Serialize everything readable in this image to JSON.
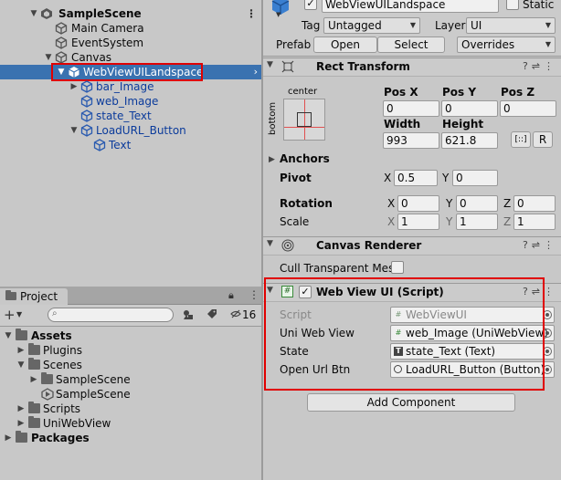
{
  "hierarchy": {
    "scene": "SampleScene",
    "items": [
      {
        "label": "Main Camera"
      },
      {
        "label": "EventSystem"
      },
      {
        "label": "Canvas"
      },
      {
        "label": "WebViewUILandspace"
      },
      {
        "label": "bar_Image"
      },
      {
        "label": "web_Image"
      },
      {
        "label": "state_Text"
      },
      {
        "label": "LoadURL_Button"
      },
      {
        "label": "Text"
      }
    ]
  },
  "project": {
    "tab": "Project",
    "lock_icon": "lock-icon",
    "hidden_count": "16",
    "items": [
      {
        "label": "Assets"
      },
      {
        "label": "Plugins"
      },
      {
        "label": "Scenes"
      },
      {
        "label": "SampleScene"
      },
      {
        "label": "SampleScene"
      },
      {
        "label": "Scripts"
      },
      {
        "label": "UniWebView"
      },
      {
        "label": "Packages"
      }
    ]
  },
  "inspector": {
    "object_name": "WebViewUILandspace",
    "static_label": "Static",
    "tag_label": "Tag",
    "tag_value": "Untagged",
    "layer_label": "Layer",
    "layer_value": "UI",
    "prefab_label": "Prefab",
    "open_label": "Open",
    "select_label": "Select",
    "overrides_label": "Overrides",
    "rect_transform": {
      "title": "Rect Transform",
      "anchor_h": "center",
      "anchor_v": "bottom",
      "posx_label": "Pos X",
      "posx": "0",
      "posy_label": "Pos Y",
      "posy": "0",
      "posz_label": "Pos Z",
      "posz": "0",
      "width_label": "Width",
      "width": "993",
      "height_label": "Height",
      "height": "621.8",
      "r_button": "R",
      "anchors_label": "Anchors",
      "pivot_label": "Pivot",
      "pivot_x": "0.5",
      "pivot_y": "0",
      "rotation_label": "Rotation",
      "rot_x": "0",
      "rot_y": "0",
      "rot_z": "0",
      "scale_label": "Scale",
      "scale_x": "1",
      "scale_y": "1",
      "scale_z": "1",
      "x": "X",
      "y": "Y",
      "z": "Z"
    },
    "canvas_renderer": {
      "title": "Canvas Renderer",
      "cull_label": "Cull Transparent Mes"
    },
    "web_view_ui": {
      "title": "Web View UI (Script)",
      "script_label": "Script",
      "script_value": "WebViewUI",
      "uni_label": "Uni Web View",
      "uni_value": "web_Image (UniWebView)",
      "state_label": "State",
      "state_value": "state_Text (Text)",
      "open_label": "Open Url Btn",
      "open_value": "LoadURL_Button (Button)"
    },
    "add_component": "Add Component"
  }
}
